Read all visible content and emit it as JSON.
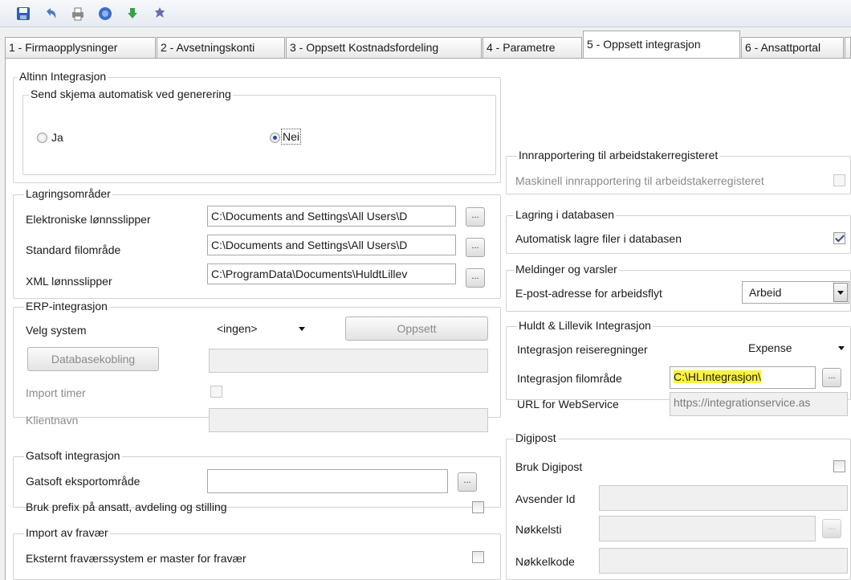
{
  "tabs": [
    {
      "label": "1 - Firmaopplysninger"
    },
    {
      "label": "2 - Avsetningskonti"
    },
    {
      "label": "3 - Oppsett Kostnadsfordeling"
    },
    {
      "label": "4 - Parametre"
    },
    {
      "label": "5 - Oppsett integrasjon"
    },
    {
      "label": "6 - Ansattportal"
    }
  ],
  "altinn": {
    "title": "Altinn Integrasjon",
    "send_title": "Send skjema automatisk ved generering",
    "ja": "Ja",
    "nei": "Nei"
  },
  "lagring": {
    "title": "Lagringsområder",
    "elektroniske_label": "Elektroniske lønnsslipper",
    "elektroniske_value": "C:\\Documents and Settings\\All Users\\D",
    "standard_label": "Standard filområde",
    "standard_value": "C:\\Documents and Settings\\All Users\\D",
    "xml_label": "XML lønnsslipper",
    "xml_value": "C:\\ProgramData\\Documents\\HuldtLillev",
    "browse": "..."
  },
  "erp": {
    "title": "ERP-integrasjon",
    "velg_label": "Velg system",
    "velg_value": "<ingen>",
    "oppsett_button": "Oppsett",
    "databasekobling_button": "Databasekobling",
    "import_timer_label": "Import timer",
    "klientnavn_label": "Klientnavn"
  },
  "gatsoft": {
    "title": "Gatsoft integrasjon",
    "eksport_label": "Gatsoft eksportområde",
    "prefix_label": "Bruk prefix på ansatt, avdeling og stilling"
  },
  "fravaer": {
    "title": "Import av fravær",
    "master_label": "Eksternt fraværssystem er master for fravær"
  },
  "arbeidstaker": {
    "title": "Innrapportering til arbeidstakerregisteret",
    "maskinell_label": "Maskinell innrapportering til arbeidstakerregisteret"
  },
  "database": {
    "title": "Lagring i databasen",
    "auto_label": "Automatisk lagre filer i databasen",
    "auto_checked": true
  },
  "meldinger": {
    "title": "Meldinger og varsler",
    "epost_label": "E-post-adresse for arbeidsflyt",
    "epost_value": "Arbeid"
  },
  "huldt": {
    "title": "Huldt & Lillevik Integrasjon",
    "reise_label": "Integrasjon reiseregninger",
    "reise_value": "Expense",
    "filomrade_label": "Integrasjon filområde",
    "filomrade_value": "C:\\HLIntegrasjon\\",
    "url_label": "URL for WebService",
    "url_value": "https://integrationservice.as"
  },
  "digipost": {
    "title": "Digipost",
    "bruk_label": "Bruk Digipost",
    "avsender_label": "Avsender Id",
    "nokkelsti_label": "Nøkkelsti",
    "nokkelkode_label": "Nøkkelkode"
  },
  "colors": {
    "highlight": "#fbf33d",
    "radio_dot": "#2a4b9b"
  },
  "toolbar_icons": [
    "save-icon",
    "undo-icon",
    "print-icon",
    "help-icon",
    "download-icon",
    "settings-icon"
  ]
}
